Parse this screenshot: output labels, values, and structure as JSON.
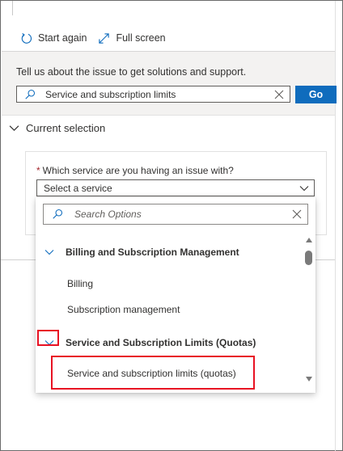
{
  "toolbar": {
    "start_again_label": "Start again",
    "full_screen_label": "Full screen"
  },
  "search_panel": {
    "prompt": "Tell us about the issue to get solutions and support.",
    "query_value": "Service and subscription limits",
    "go_label": "Go"
  },
  "current_selection": {
    "heading": "Current selection",
    "field_label": "Which service are you having an issue with?",
    "required_marker": "*",
    "select_value": "Select a service"
  },
  "dropdown": {
    "search_placeholder": "Search Options",
    "groups": [
      {
        "label": "Billing and Subscription Management",
        "options": [
          "Billing",
          "Subscription management"
        ]
      },
      {
        "label": "Service and Subscription Limits (Quotas)",
        "options": [
          "Service and subscription limits (quotas)"
        ]
      }
    ]
  },
  "colors": {
    "accent": "#0f6cbd",
    "highlight": "#e81123",
    "required": "#a4262c"
  },
  "icons": {
    "start_again": "refresh-icon",
    "full_screen": "expand-icon",
    "search": "search-icon",
    "clear": "close-icon",
    "chevron": "chevron-down-icon"
  }
}
